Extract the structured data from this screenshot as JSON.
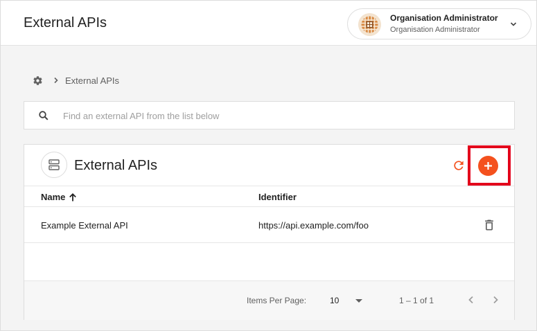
{
  "header": {
    "title": "External APIs",
    "user": {
      "name": "Organisation Administrator",
      "role": "Organisation Administrator",
      "avatar_icon": "organisation-logo-icon"
    }
  },
  "breadcrumb": {
    "home_icon": "gear-icon",
    "items": [
      "External APIs"
    ]
  },
  "search": {
    "placeholder": "Find an external API from the list below",
    "value": ""
  },
  "card": {
    "title": "External APIs",
    "icon": "server-icon",
    "actions": {
      "refresh_icon": "refresh-icon",
      "add_icon": "plus-icon"
    }
  },
  "table": {
    "columns": [
      {
        "label": "Name",
        "sort": "ascending"
      },
      {
        "label": "Identifier"
      }
    ],
    "rows": [
      {
        "name": "Example External API",
        "identifier": "https://api.example.com/foo",
        "action_icon": "trash-icon"
      }
    ]
  },
  "paginator": {
    "items_per_page_label": "Items Per Page:",
    "items_per_page": "10",
    "range_label": "1 – 1 of 1"
  },
  "colors": {
    "accent": "#f4511e",
    "highlight": "#e3001b"
  }
}
